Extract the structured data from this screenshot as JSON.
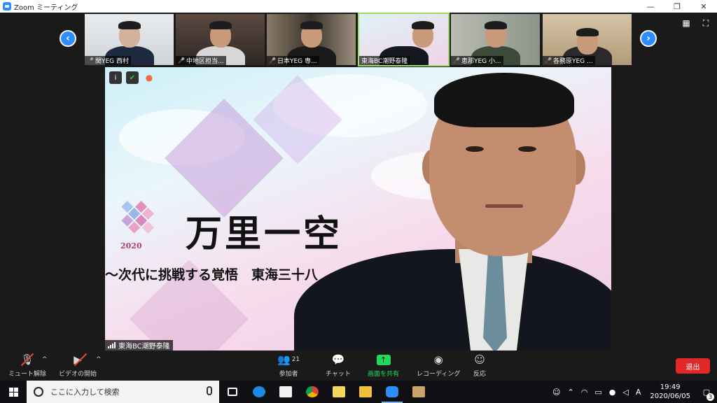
{
  "window": {
    "title": "Zoom ミーティング",
    "minimize": "—",
    "restore": "❐",
    "close": "✕"
  },
  "gallery": {
    "prev": "‹",
    "next": "›",
    "participants": [
      {
        "name": "関YEG 西村",
        "muted": true
      },
      {
        "name": "中地区担当...",
        "muted": true
      },
      {
        "name": "日本YEG 専...",
        "muted": true
      },
      {
        "name": "東海BC潮野泰隆",
        "muted": false
      },
      {
        "name": "恵那YEG 小...",
        "muted": true
      },
      {
        "name": "各務原YEG ...",
        "muted": true
      }
    ],
    "grid_icon": "▦",
    "fullscreen_icon": "⛶"
  },
  "speaker": {
    "name": "東海BC潮野泰隆",
    "slide": {
      "calligraphy": "万里一空",
      "year": "2020",
      "subtitle": "〜次代に挑戦する覚悟　東海三十八"
    },
    "overlay": {
      "info": "i",
      "shield": "✔",
      "rec": "●"
    }
  },
  "controls": {
    "mute": "ミュート解除",
    "video": "ビデオの開始",
    "participants": "参加者",
    "participants_count": "21",
    "chat": "チャット",
    "share": "画面を共有",
    "record": "レコーディング",
    "reactions": "反応",
    "leave": "退出",
    "caret": "^"
  },
  "taskbar": {
    "search_placeholder": "ここに入力して検索",
    "time": "19:49",
    "date": "2020/06/05",
    "ime": "A",
    "notifications": "3"
  }
}
